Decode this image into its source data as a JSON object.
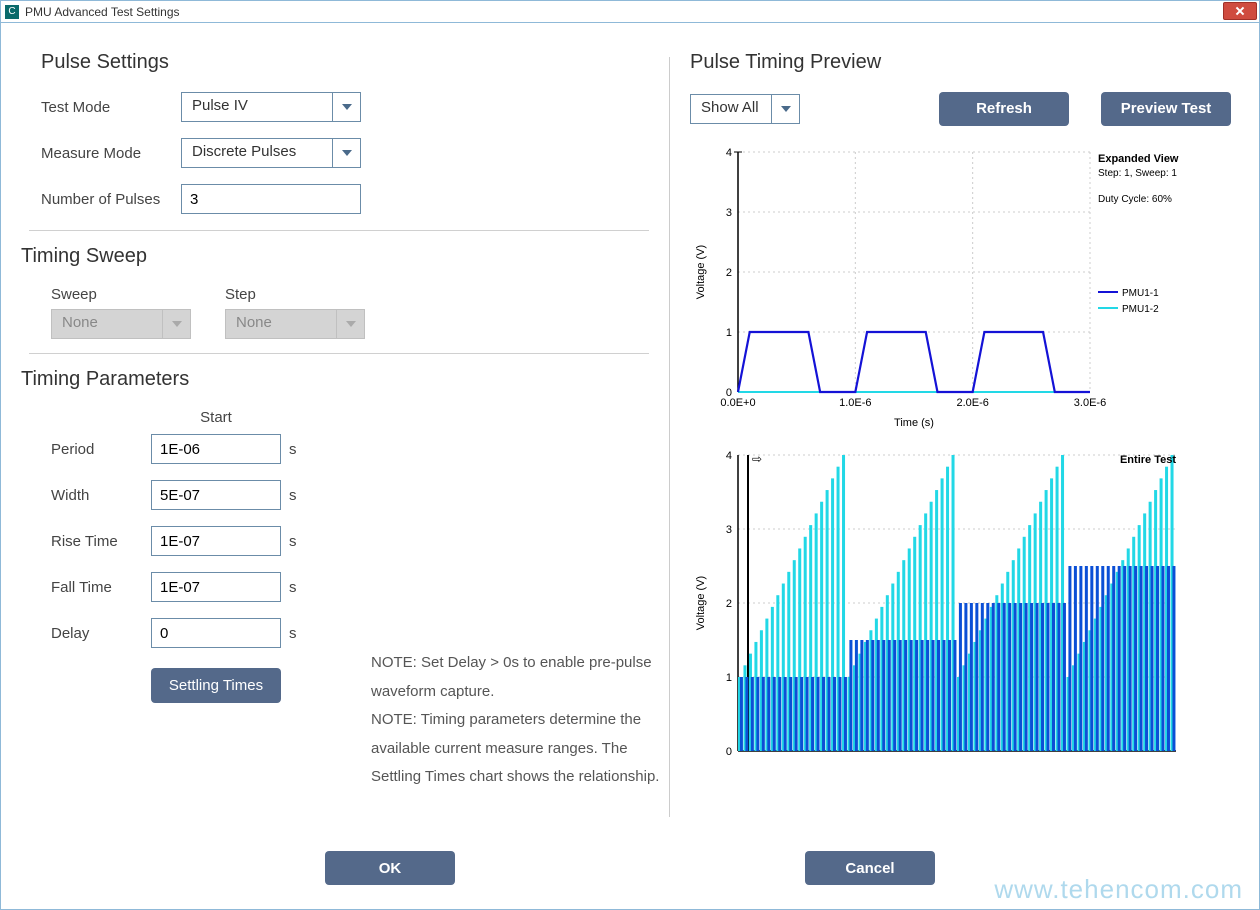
{
  "window": {
    "title": "PMU Advanced Test Settings"
  },
  "pulse_settings": {
    "heading": "Pulse Settings",
    "test_mode_label": "Test Mode",
    "test_mode_value": "Pulse IV",
    "measure_mode_label": "Measure Mode",
    "measure_mode_value": "Discrete Pulses",
    "num_pulses_label": "Number of Pulses",
    "num_pulses_value": "3"
  },
  "timing_sweep": {
    "heading": "Timing Sweep",
    "sweep_label": "Sweep",
    "sweep_value": "None",
    "step_label": "Step",
    "step_value": "None"
  },
  "timing_params": {
    "heading": "Timing Parameters",
    "start_header": "Start",
    "period": {
      "label": "Period",
      "value": "1E-06",
      "unit": "s"
    },
    "width": {
      "label": "Width",
      "value": "5E-07",
      "unit": "s"
    },
    "rise": {
      "label": "Rise Time",
      "value": "1E-07",
      "unit": "s"
    },
    "fall": {
      "label": "Fall Time",
      "value": "1E-07",
      "unit": "s"
    },
    "delay": {
      "label": "Delay",
      "value": "0",
      "unit": "s"
    },
    "settling_btn": "Settling Times"
  },
  "notes": {
    "line1": "NOTE: Set Delay > 0s to enable pre-pulse waveform capture.",
    "line2": "NOTE: Timing parameters determine the available current measure ranges. The Settling Times chart shows the relationship."
  },
  "preview": {
    "heading": "Pulse Timing Preview",
    "show_value": "Show All",
    "refresh_btn": "Refresh",
    "preview_btn": "Preview Test"
  },
  "footer": {
    "ok": "OK",
    "cancel": "Cancel"
  },
  "watermark": "www.tehencom.com",
  "chart_data": [
    {
      "type": "line",
      "title_right": "Expanded View",
      "sub1": "Step: 1, Sweep: 1",
      "sub2": "Duty Cycle: 60%",
      "xlabel": "Time (s)",
      "ylabel": "Voltage (V)",
      "xlim": [
        0,
        3e-06
      ],
      "ylim": [
        0,
        4
      ],
      "xticks": [
        0,
        1e-06,
        2e-06,
        3e-06
      ],
      "xticklabels": [
        "0.0E+0",
        "1.0E-6",
        "2.0E-6",
        "3.0E-6"
      ],
      "yticks": [
        0,
        1,
        2,
        3,
        4
      ],
      "pulse": {
        "base": 0,
        "amp": 1,
        "period": 1e-06,
        "rise": 1e-07,
        "width": 5e-07,
        "fall": 1e-07,
        "count": 3
      },
      "series": [
        {
          "name": "PMU1-1",
          "color": "#1412d6"
        },
        {
          "name": "PMU1-2",
          "color": "#22d8e6"
        }
      ]
    },
    {
      "type": "line",
      "title_right": "Entire Test",
      "xlabel": "",
      "ylabel": "Voltage (V)",
      "xlim": [
        0,
        1
      ],
      "ylim": [
        0,
        4
      ],
      "yticks": [
        0,
        1,
        2,
        3,
        4
      ],
      "groups": 4,
      "bars_per_group": 20,
      "blue_levels": [
        1.0,
        1.5,
        2.0,
        2.5
      ],
      "cyan_peak": 4.0,
      "colors": {
        "blue": "#0b4fd6",
        "cyan": "#22d8e6"
      }
    }
  ]
}
